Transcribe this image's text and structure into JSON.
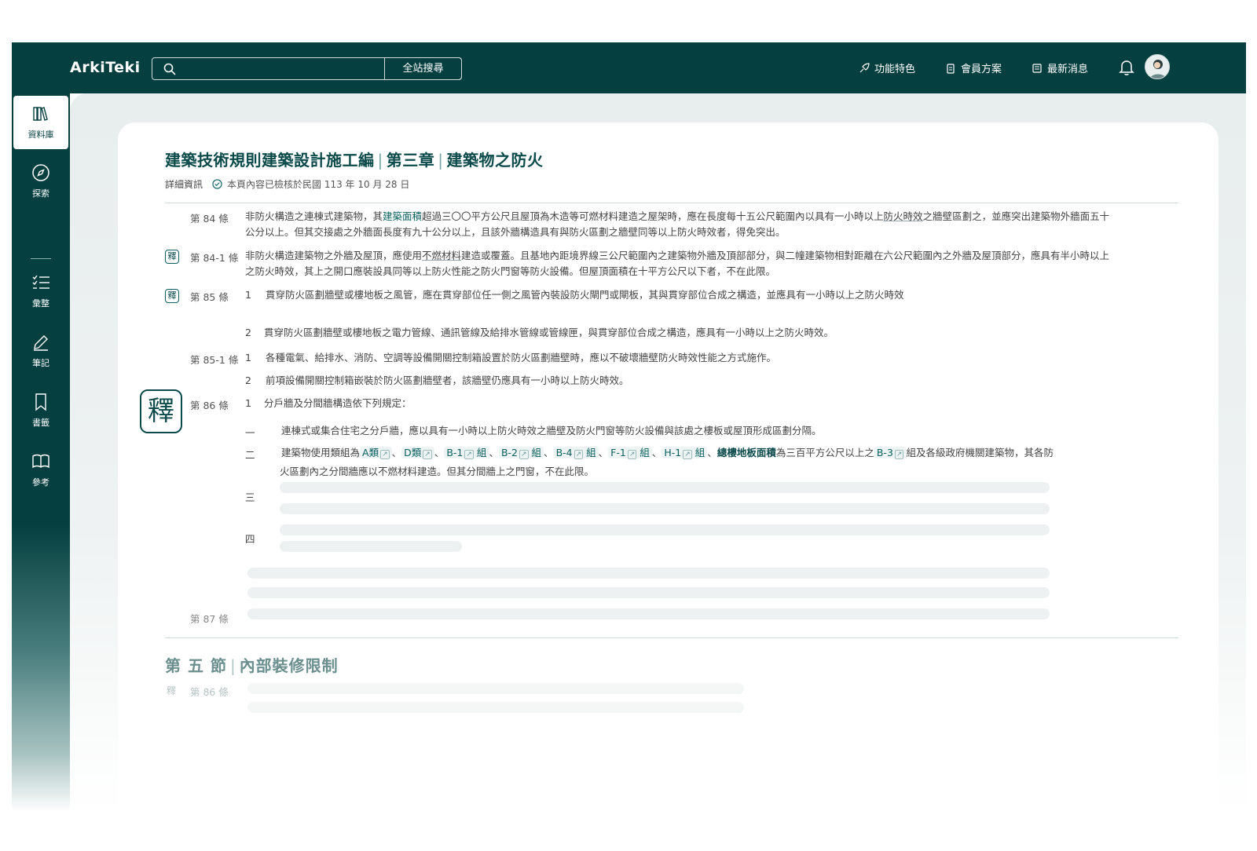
{
  "app": {
    "logo": "ArkiTeki",
    "search": {
      "placeholder": "",
      "button_label": "全站搜尋"
    },
    "nav": [
      {
        "label": "功能特色",
        "icon": "rocket-icon"
      },
      {
        "label": "會員方案",
        "icon": "clipboard-icon"
      },
      {
        "label": "最新消息",
        "icon": "newspaper-icon"
      }
    ]
  },
  "sidebar": {
    "items": [
      {
        "label": "資料庫",
        "icon": "library-icon",
        "active": true
      },
      {
        "label": "探索",
        "icon": "compass-icon"
      },
      {
        "label": "彙整",
        "icon": "checklist-icon"
      },
      {
        "label": "筆記",
        "icon": "pen-icon"
      },
      {
        "label": "書籤",
        "icon": "bookmark-icon"
      },
      {
        "label": "參考",
        "icon": "book-open-icon"
      }
    ]
  },
  "document": {
    "title_part1": "建築技術規則建築設計施工編",
    "title_sep": "|",
    "title_part2": "第三章",
    "title_part3": "建築物之防火",
    "detail_label": "詳細資訊",
    "verified_text": "本頁內容已檢核於民國 113 年 10 月 28 日",
    "shi_label": "釋",
    "articles": {
      "a84": {
        "label": "第 84 條",
        "t1": "非防火構造之連棟式建築物，其",
        "t_term1": "建築面積",
        "t2": "超過三〇〇平方公尺且屋頂為木造等可燃材料建造之屋架時，應在長度每十五公尺範圍內以具有一小時以上",
        "t_term2": "防火時效",
        "t3": "之牆壁區劃之，並應突出建築物外牆面五十公分以上。但其交接處之外牆面長度有九十公分以上，且該外牆構造具有與防火區劃之牆壁同等以上防火時效者，得免突出。"
      },
      "a84_1": {
        "label": "第 84-1 條",
        "t1": "非防火構造建築物之外牆及屋頂，應使用",
        "t_term1": "不燃材料",
        "t2": "建造或覆蓋。且基地內距境界線三公尺範圍內之建築物外牆及頂部部分，與二幢建築物相對距離在六公尺範圍內之外牆及屋頂部分，應具有半小時以上之防火時效，其上之開口應裝設具同等以上防火性能之防火門窗等防火設備。但屋頂面積在十平方公尺以下者，不在此限。"
      },
      "a85": {
        "label": "第 85 條",
        "n1": "1",
        "p1": "貫穿防火區劃牆壁或樓地板之風管，應在貫穿部位任一側之風管內裝設防火閘門或閘板，其與貫穿部位合成之構造，並應具有一小時以上之防火時效",
        "n2": "2",
        "p2": "貫穿防火區劃牆壁或樓地板之電力管線、通訊管線及給排水管線或管線匣，與貫穿部位合成之構造，應具有一小時以上之防火時效。"
      },
      "a85_1": {
        "label": "第 85-1 條",
        "n1": "1",
        "p1": "各種電氣、給排水、消防、空調等設備開關控制箱設置於防火區劃牆壁時，應以不破壞牆壁防火時效性能之方式施作。",
        "n2": "2",
        "p2": "前項設備開關控制箱嵌裝於防火區劃牆壁者，該牆壁仍應具有一小時以上防火時效。"
      },
      "a86": {
        "label": "第 86 條",
        "n1": "1",
        "p1": "分戶牆及分間牆構造依下列規定：",
        "i1_label": "一",
        "i1_a": "連棟式或",
        "i1_term": "集合住宅",
        "i1_b": "之分戶牆，應以具有一小時以上防火時效之牆壁及防火門窗等防火設備與該處之樓板或屋頂形成區劃分隔。",
        "i2_label": "二",
        "i2_a": "建築物使用類組為",
        "i2_tags": [
          "A類",
          "D類",
          "B-1",
          "B-2",
          "B-4",
          "F-1",
          "H-1",
          "B-3"
        ],
        "i2_group": "組",
        "i2_term": "總樓地板面積",
        "i2_b": "為三百平方公尺以上之",
        "i2_c": "組及各級政府機關建築物，其各防",
        "i2_d": "火區劃內之分間牆應以不燃材料建造。但其分間牆上之門窗，不在此限。",
        "i3_label": "三",
        "i4_label": "四"
      },
      "a87": {
        "label": "第 87 條"
      }
    },
    "section": {
      "part1": "第 五 節",
      "sep": "|",
      "part2": "內部裝修限制",
      "first_label": "第 86 條"
    }
  }
}
